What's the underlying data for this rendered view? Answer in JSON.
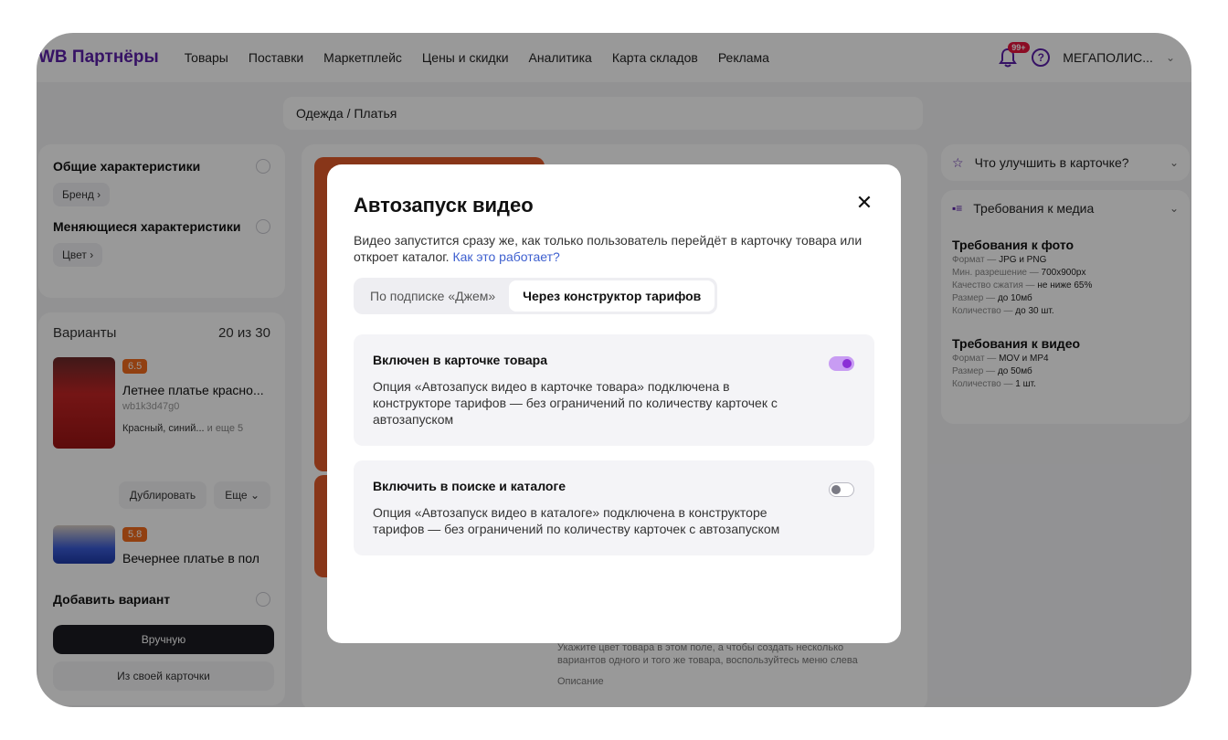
{
  "header": {
    "logo": "WB Партнёры",
    "nav": [
      "Товары",
      "Поставки",
      "Маркетплейс",
      "Цены и скидки",
      "Аналитика",
      "Карта складов",
      "Реклама"
    ],
    "notifications_badge": "99+",
    "help_glyph": "?",
    "account": "МЕГАПОЛИС...",
    "account_chevron": "⌄"
  },
  "breadcrumb": "Одежда / Платья",
  "left": {
    "general_title": "Общие характеристики",
    "brand_chip": "Бренд  ›",
    "changing_title": "Меняющиеся характеристики",
    "color_chip": "Цвет  ›",
    "variants_title": "Варианты",
    "variants_count": "20 из 30",
    "product1": {
      "rating": "6.5",
      "name": "Летнее платье красно...",
      "sku": "wb1k3d47g0",
      "colors": "Красный, синий...",
      "colors_more": " и еще 5"
    },
    "duplicate_button": "Дублировать",
    "more_button": "Еще ⌄",
    "product2": {
      "rating": "5.8",
      "name": "Вечернее платье в пол"
    },
    "add_variant_title": "Добавить вариант",
    "manual_button": "Вручную",
    "from_card_button": "Из своей карточки"
  },
  "center": {
    "hint_text": "Укажите цвет товара в этом поле, а чтобы создать несколько вариантов одного и того же товара, воспользуйтесь меню слева",
    "description_label": "Описание"
  },
  "right": {
    "improve_title": "Что улучшить в карточке?",
    "media_req_title": "Требования к медиа",
    "photo_title": "Требования к фото",
    "photo_lines": [
      {
        "label": "Формат — ",
        "value": "JPG и PNG"
      },
      {
        "label": "Мин. разрешение — ",
        "value": "700x900px"
      },
      {
        "label": "Качество сжатия — ",
        "value": "не ниже 65%"
      },
      {
        "label": "Размер — ",
        "value": "до 10мб"
      },
      {
        "label": "Количество — ",
        "value": "до 30 шт."
      }
    ],
    "video_title": "Требования к видео",
    "video_lines": [
      {
        "label": "Формат — ",
        "value": "MOV и MP4"
      },
      {
        "label": "Размер — ",
        "value": "до 50мб"
      },
      {
        "label": "Количество — ",
        "value": "1 шт."
      }
    ]
  },
  "modal": {
    "title": "Автозапуск видео",
    "close_glyph": "✕",
    "description": "Видео запустится сразу же, как только пользователь перейдёт в карточку товара или откроет каталог. ",
    "how_link": "Как это работает?",
    "tabs": [
      "По подписке «Джем»",
      "Через конструктор тарифов"
    ],
    "active_tab": 1,
    "options": [
      {
        "title": "Включен в карточке товара",
        "text": "Опция «Автозапуск видео в карточке товара» подключена в конструкторе тарифов — без ограничений по количеству карточек с автозапуском",
        "enabled": true
      },
      {
        "title": "Включить в поиске и каталоге",
        "text": "Опция «Автозапуск видео в каталоге» подключена в конструкторе тарифов — без ограничений по количеству карточек с автозапуском",
        "enabled": false
      }
    ]
  },
  "colors": {
    "brand": "#5b1fa8",
    "toggle_on": "#8a2ed6",
    "link": "#3d5fcf",
    "rating": "#f26b1d"
  }
}
